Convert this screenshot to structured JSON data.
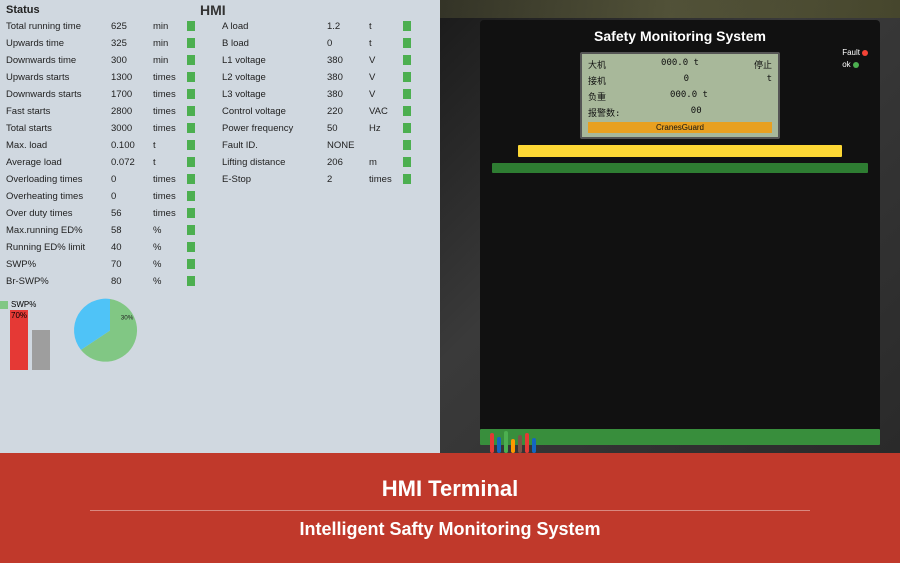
{
  "header": {
    "status_title": "Status"
  },
  "left_column": {
    "rows": [
      {
        "label": "Total running time",
        "value": "625",
        "unit": "min",
        "indicator": "green"
      },
      {
        "label": "Upwards time",
        "value": "325",
        "unit": "min",
        "indicator": "green"
      },
      {
        "label": "Downwards time",
        "value": "300",
        "unit": "min",
        "indicator": "green"
      },
      {
        "label": "Upwards starts",
        "value": "1300",
        "unit": "times",
        "indicator": "green"
      },
      {
        "label": "Downwards starts",
        "value": "1700",
        "unit": "times",
        "indicator": "green"
      },
      {
        "label": "Fast starts",
        "value": "2800",
        "unit": "times",
        "indicator": "green"
      },
      {
        "label": "Total starts",
        "value": "3000",
        "unit": "times",
        "indicator": "green"
      },
      {
        "label": "Max. load",
        "value": "0.100",
        "unit": "t",
        "indicator": "green"
      },
      {
        "label": "Average load",
        "value": "0.072",
        "unit": "t",
        "indicator": "green"
      },
      {
        "label": "Overloading times",
        "value": "0",
        "unit": "times",
        "indicator": "green"
      },
      {
        "label": "Overheating times",
        "value": "0",
        "unit": "times",
        "indicator": "green"
      },
      {
        "label": "Over duty times",
        "value": "56",
        "unit": "times",
        "indicator": "green"
      },
      {
        "label": "Max.running ED%",
        "value": "58",
        "unit": "%",
        "indicator": "green"
      },
      {
        "label": "Running ED% limit",
        "value": "40",
        "unit": "%",
        "indicator": "green"
      },
      {
        "label": "SWP%",
        "value": "70",
        "unit": "%",
        "indicator": "green"
      },
      {
        "label": "Br-SWP%",
        "value": "80",
        "unit": "%",
        "indicator": "green"
      }
    ]
  },
  "right_column": {
    "rows": [
      {
        "label": "A load",
        "value": "1.2",
        "unit": "t",
        "indicator": "green"
      },
      {
        "label": "B load",
        "value": "0",
        "unit": "t",
        "indicator": "green"
      },
      {
        "label": "L1 voltage",
        "value": "380",
        "unit": "V",
        "indicator": "green"
      },
      {
        "label": "L2 voltage",
        "value": "380",
        "unit": "V",
        "indicator": "green"
      },
      {
        "label": "L3 voltage",
        "value": "380",
        "unit": "V",
        "indicator": "green"
      },
      {
        "label": "Control voltage",
        "value": "220",
        "unit": "VAC",
        "indicator": "green"
      },
      {
        "label": "Power frequency",
        "value": "50",
        "unit": "Hz",
        "indicator": "green"
      },
      {
        "label": "Fault ID.",
        "value": "NONE",
        "unit": "",
        "indicator": "green"
      },
      {
        "label": "Lifting distance",
        "value": "206",
        "unit": "m",
        "indicator": "green"
      },
      {
        "label": "E-Stop",
        "value": "2",
        "unit": "times",
        "indicator": "green"
      }
    ]
  },
  "hmi_label": "HMI",
  "pie_chart": {
    "segment1_label": "SWP%",
    "segment1_value": "70%",
    "segment1_pct": 70,
    "segment2_label": "",
    "segment2_value": "30%",
    "segment2_pct": 30
  },
  "device": {
    "title": "Safety Monitoring System",
    "lcd_rows": [
      {
        "left": "大机",
        "mid": "000.0 t",
        "right": "停止"
      },
      {
        "left": "接机",
        "mid": "0",
        "right": "t"
      },
      {
        "left": "负重",
        "mid": "000.0 t",
        "right": ""
      },
      {
        "left": "报警数:",
        "mid": "00",
        "right": ""
      },
      {
        "left": "CranesGuard",
        "mid": "",
        "right": ""
      }
    ],
    "fault_label": "Fault",
    "ok_label": "ok"
  },
  "banner": {
    "title": "HMI Terminal",
    "subtitle": "Intelligent Safty Monitoring System"
  }
}
